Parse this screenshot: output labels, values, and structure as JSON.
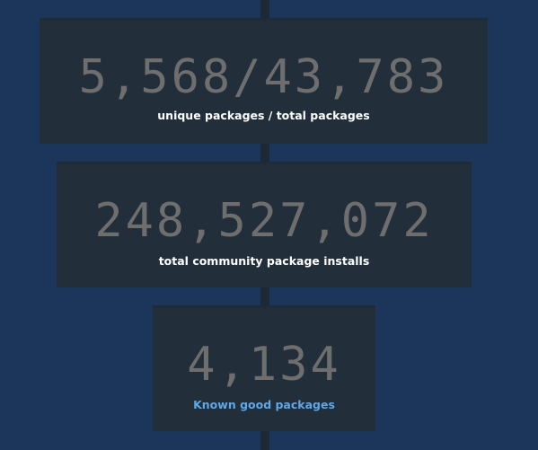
{
  "stats": [
    {
      "value": "5,568/43,783",
      "label": "unique packages / total packages"
    },
    {
      "value": "248,527,072",
      "label": "total community package installs"
    },
    {
      "value": "4,134",
      "label": "Known good packages"
    }
  ],
  "colors": {
    "background": "#1b365a",
    "card": "#222e3a",
    "number": "#6e6e6e",
    "label": "#ffffff",
    "link": "#5fa8e6"
  }
}
